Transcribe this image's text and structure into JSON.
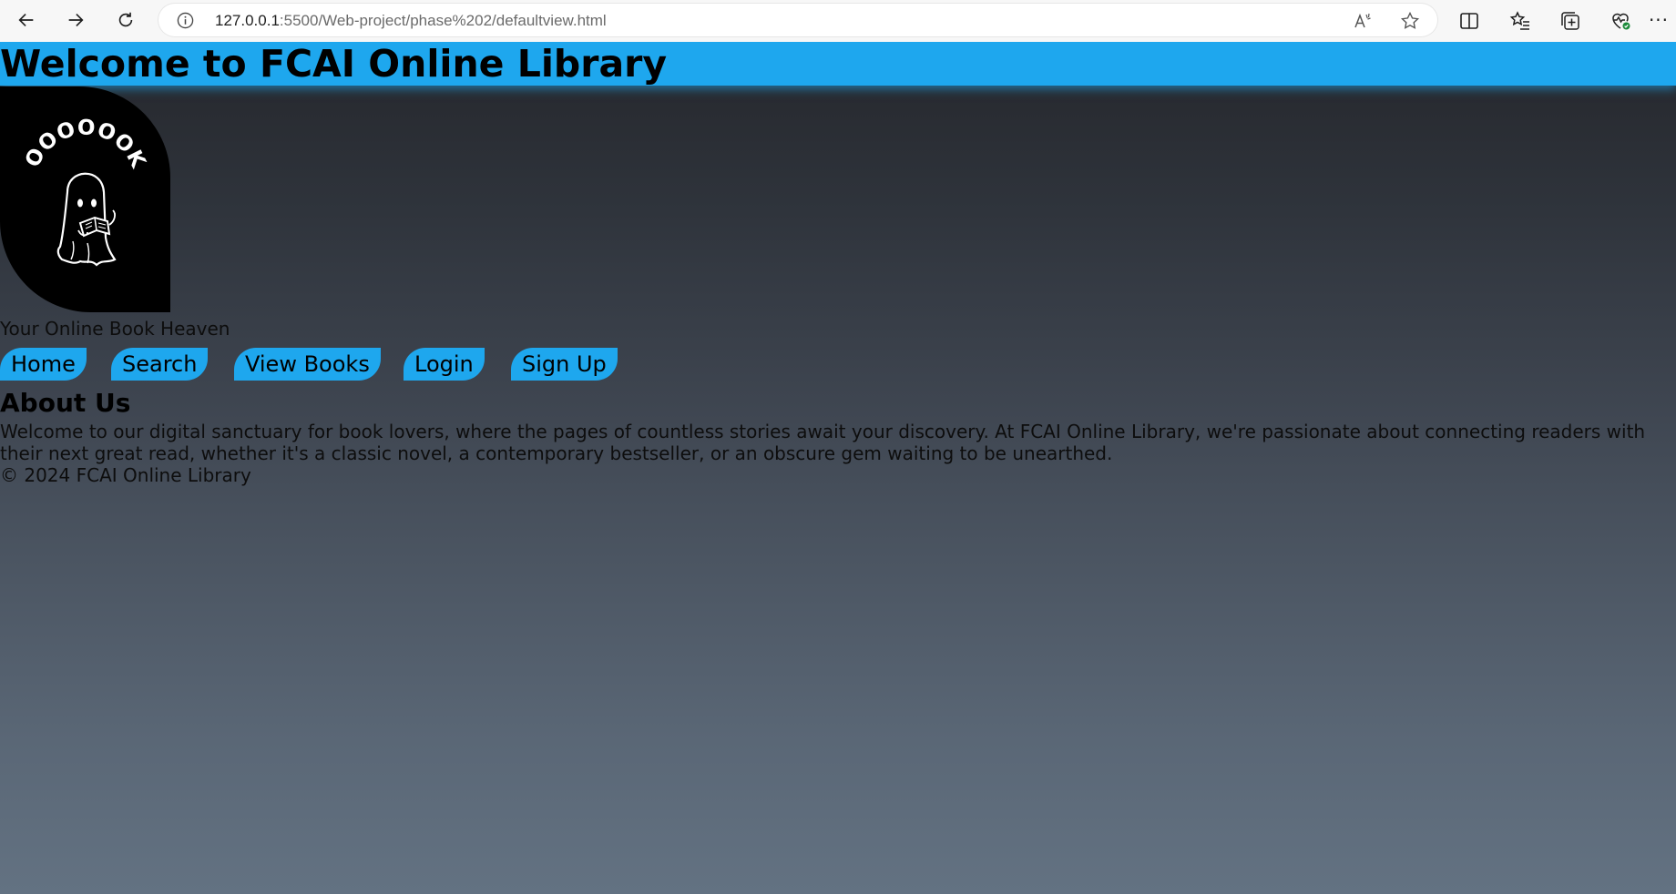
{
  "browser": {
    "url_host": "127.0.0.1",
    "url_path": ":5500/Web-project/phase%202/defaultview.html"
  },
  "page": {
    "banner_title": "Welcome to FCAI Online Library",
    "logo_text": "BOOOOOOKS",
    "tagline": "Your Online Book Heaven",
    "nav": [
      {
        "label": "Home"
      },
      {
        "label": "Search"
      },
      {
        "label": "View Books"
      },
      {
        "label": "Login"
      },
      {
        "label": "Sign Up"
      }
    ],
    "about": {
      "title": "About Us",
      "text": "Welcome to our digital sanctuary for book lovers, where the pages of countless stories await your discovery. At FCAI Online Library, we're passionate about connecting readers with their next great read, whether it's a classic novel, a contemporary bestseller, or an obscure gem waiting to be unearthed."
    },
    "footer": "© 2024 FCAI Online Library"
  },
  "colors": {
    "banner": "#1ea7ee",
    "nav_button": "#1ea7ee",
    "logo_bg": "#000000",
    "gradient_top": "#25272c",
    "gradient_bottom": "#637282"
  },
  "icons": [
    "back-arrow-icon",
    "forward-arrow-icon",
    "refresh-icon",
    "site-info-icon",
    "read-aloud-icon",
    "favorite-star-icon",
    "split-screen-icon",
    "favorites-icon",
    "collections-icon",
    "browser-essentials-icon",
    "more-icon"
  ]
}
